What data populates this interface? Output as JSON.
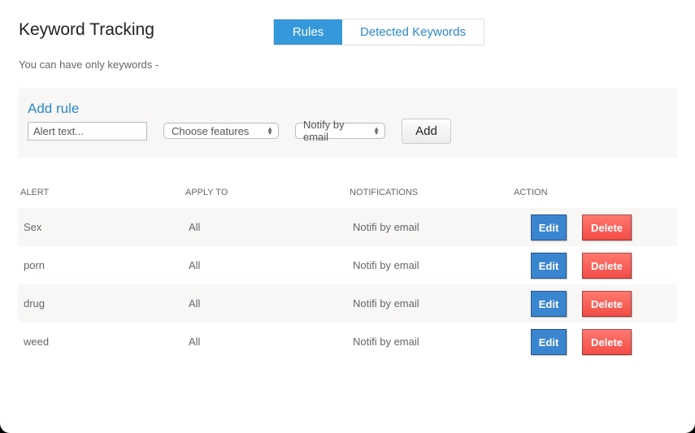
{
  "header": {
    "title": "Keyword Tracking",
    "subtitle": "You can have only keywords -"
  },
  "tabs": [
    {
      "label": "Rules",
      "active": true
    },
    {
      "label": "Detected Keywords",
      "active": false
    }
  ],
  "add_rule": {
    "title": "Add rule",
    "alert_placeholder": "Alert text...",
    "alert_value": "",
    "features_select": "Choose features",
    "notify_select": "Notify by email",
    "add_label": "Add"
  },
  "table": {
    "headers": [
      "ALERT",
      "APPLY TO",
      "NOTIFICATIONS",
      "ACTION"
    ],
    "rows": [
      {
        "alert": "Sex",
        "apply_to": "All",
        "notification": "Notifi by email",
        "edit": "Edit",
        "delete": "Delete"
      },
      {
        "alert": "porn",
        "apply_to": "All",
        "notification": "Notifi by email",
        "edit": "Edit",
        "delete": "Delete"
      },
      {
        "alert": "drug",
        "apply_to": "All",
        "notification": "Notifi by email",
        "edit": "Edit",
        "delete": "Delete"
      },
      {
        "alert": "weed",
        "apply_to": "All",
        "notification": "Notifi by email",
        "edit": "Edit",
        "delete": "Delete"
      }
    ]
  },
  "colors": {
    "accent": "#3498db",
    "link": "#2a88d0",
    "edit": "#3a85d0",
    "delete": "#f24b44"
  }
}
